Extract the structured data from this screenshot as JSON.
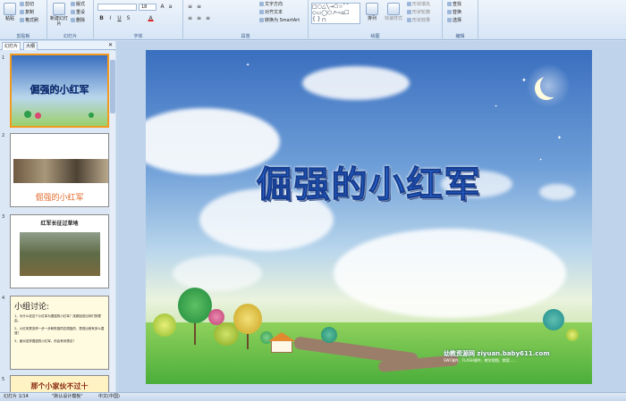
{
  "ribbon": {
    "clipboard": {
      "paste": "粘贴",
      "cut": "剪切",
      "copy": "复制",
      "painter": "格式刷",
      "label": "剪贴板"
    },
    "slides": {
      "new_slide": "新建幻灯片",
      "layout": "版式",
      "reset": "重设",
      "delete": "删除",
      "label": "幻灯片"
    },
    "font": {
      "size": "18",
      "label": "字体"
    },
    "paragraph": {
      "text_direction": "文字方向",
      "align_text": "对齐文本",
      "smartart": "转换为 SmartArt",
      "label": "段落"
    },
    "drawing": {
      "arrange": "排列",
      "quick_styles": "快速样式",
      "shape_fill": "形状填充",
      "shape_outline": "形状轮廓",
      "shape_effects": "形状效果",
      "label": "绘图"
    },
    "editing": {
      "find": "查找",
      "replace": "替换",
      "select": "选择",
      "label": "编辑"
    }
  },
  "panel": {
    "tab_slides": "幻灯片",
    "tab_outline": "大纲"
  },
  "thumbs": [
    {
      "num": "1",
      "title": "倔强的小红军"
    },
    {
      "num": "2",
      "caption": "倔强的小红军"
    },
    {
      "num": "3",
      "title": "红军长征过草地"
    },
    {
      "num": "4",
      "title": "小组讨论:",
      "lines": [
        "1、为什么说这个小红军为倔强的小红军？找原因说出你们的理由。",
        "2、小红军是怎样一步一步和陈赓同志周旋的，表现出他有多么倔强？",
        "3、面对这样倔强的小红军，你会有何想法？"
      ]
    },
    {
      "num": "5",
      "title": "那个小家伙不过十"
    }
  ],
  "slide": {
    "title": "倔强的小红军",
    "watermark": "幼教资源网 ziyuan.baby611.com",
    "watermark_sub": "SWF课件、FLASH课件、教学视频、教案……"
  },
  "status": {
    "slide_info": "幻灯片 1/14",
    "theme": "\"默认设计模板\"",
    "lang": "中文(中国)"
  },
  "colors": {
    "accent": "#f29a1f",
    "title_blue": "#2d6fe0"
  }
}
